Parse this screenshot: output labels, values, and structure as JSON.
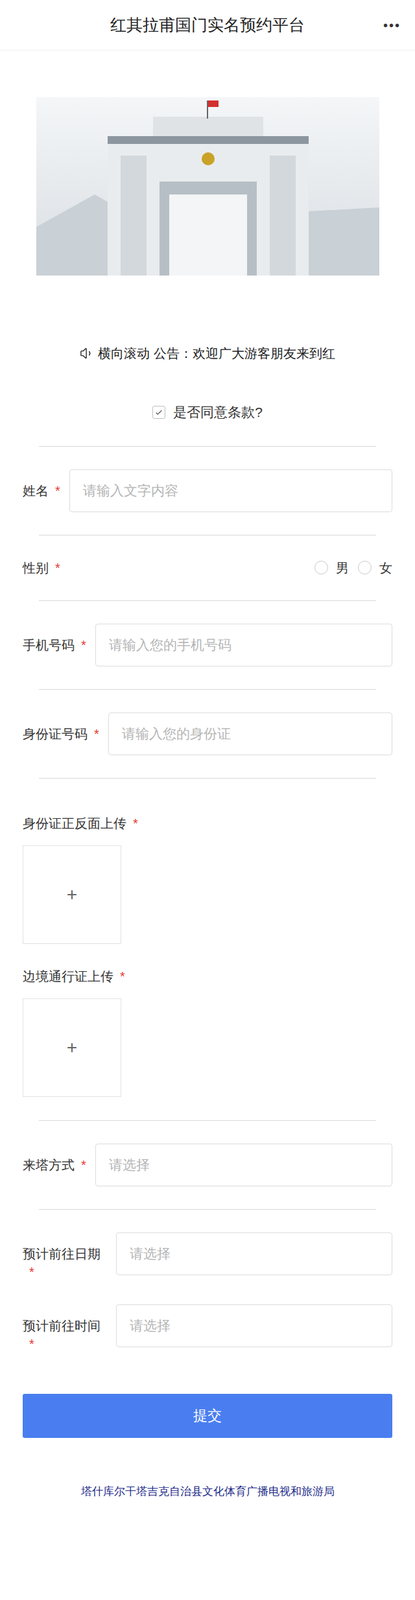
{
  "header": {
    "title": "红其拉甫国门实名预约平台",
    "menu": "•••"
  },
  "notice": {
    "label": "横向滚动",
    "text": "公告：欢迎广大游客朋友来到红"
  },
  "agreement": {
    "label": "是否同意条款?",
    "checked": true
  },
  "required_mark": "*",
  "sections": [
    [
      {
        "kind": "text",
        "label": "姓名",
        "required": true,
        "placeholder": "请输入文字内容"
      }
    ],
    [
      {
        "kind": "radio",
        "label": "性别",
        "required": true,
        "options": [
          {
            "label": "男",
            "selected": false
          },
          {
            "label": "女",
            "selected": false
          }
        ]
      }
    ],
    [
      {
        "kind": "text",
        "label": "手机号码",
        "required": true,
        "placeholder": "请输入您的手机号码"
      }
    ],
    [
      {
        "kind": "text",
        "label": "身份证号码",
        "required": true,
        "placeholder": "请输入您的身份证"
      }
    ],
    [
      {
        "kind": "upload",
        "label": "身份证正反面上传",
        "required": true,
        "button": "+"
      },
      {
        "kind": "upload",
        "label": "边境通行证上传",
        "required": true,
        "button": "+"
      }
    ],
    [
      {
        "kind": "select",
        "label": "来塔方式",
        "required": true,
        "placeholder": "请选择"
      }
    ],
    [
      {
        "kind": "select",
        "label": "预计前往日期",
        "required": true,
        "placeholder": "请选择"
      },
      {
        "kind": "select",
        "label": "预计前往时间",
        "required": true,
        "placeholder": "请选择"
      }
    ]
  ],
  "submit": "提交",
  "footer": "塔什库尔干塔吉克自治县文化体育广播电视和旅游局"
}
